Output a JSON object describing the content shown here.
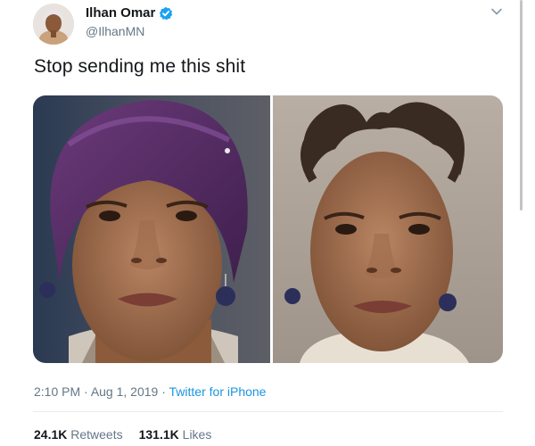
{
  "tweet": {
    "author": {
      "name": "Ilhan Omar",
      "handle": "@IlhanMN",
      "verified": true,
      "avatar_icon": "profile-avatar"
    },
    "text": "Stop sending me this shit",
    "media": {
      "count": 2,
      "left_photo": "photo-woman-purple-headscarf",
      "right_photo": "photo-woman-without-headscarf"
    },
    "meta": {
      "time": "2:10 PM",
      "separator": " · ",
      "date": "Aug 1, 2019",
      "source": "Twitter for iPhone"
    },
    "stats": {
      "retweets_count": "24.1K",
      "retweets_label": "Retweets",
      "likes_count": "131.1K",
      "likes_label": "Likes"
    }
  },
  "colors": {
    "text": "#14171a",
    "secondary": "#657786",
    "accent": "#1b95e0",
    "verified": "#1da1f2",
    "divider": "#e6ecf0"
  },
  "icons": {
    "verified": "verified-badge-icon",
    "menu": "chevron-down-icon"
  }
}
